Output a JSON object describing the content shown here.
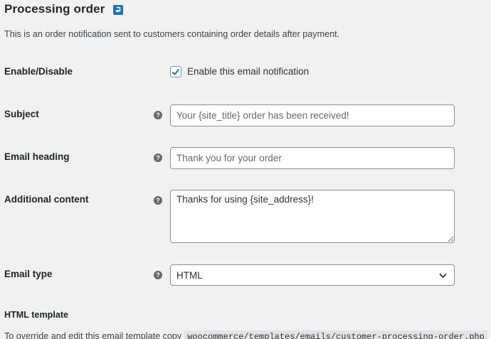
{
  "header": {
    "title": "Processing order",
    "description": "This is an order notification sent to customers containing order details after payment."
  },
  "fields": {
    "enable": {
      "label": "Enable/Disable",
      "checkbox_label": "Enable this email notification",
      "checked": true
    },
    "subject": {
      "label": "Subject",
      "placeholder": "Your {site_title} order has been received!",
      "value": ""
    },
    "heading": {
      "label": "Email heading",
      "placeholder": "Thank you for your order",
      "value": ""
    },
    "additional": {
      "label": "Additional content",
      "value": "Thanks for using {site_address}!"
    },
    "email_type": {
      "label": "Email type",
      "selected": "HTML"
    }
  },
  "template_section": {
    "heading": "HTML template",
    "override_text": "To override and edit this email template copy",
    "template_path": "woocommerce/templates/emails/customer-processing-order.php"
  },
  "colors": {
    "background": "#f1f1f1",
    "accent": "#2271b1",
    "help_icon": "#646970"
  },
  "icons": {
    "back": "up-return-arrow-icon",
    "help": "question-mark-icon",
    "check": "check-icon",
    "dropdown": "chevron-down-icon"
  }
}
